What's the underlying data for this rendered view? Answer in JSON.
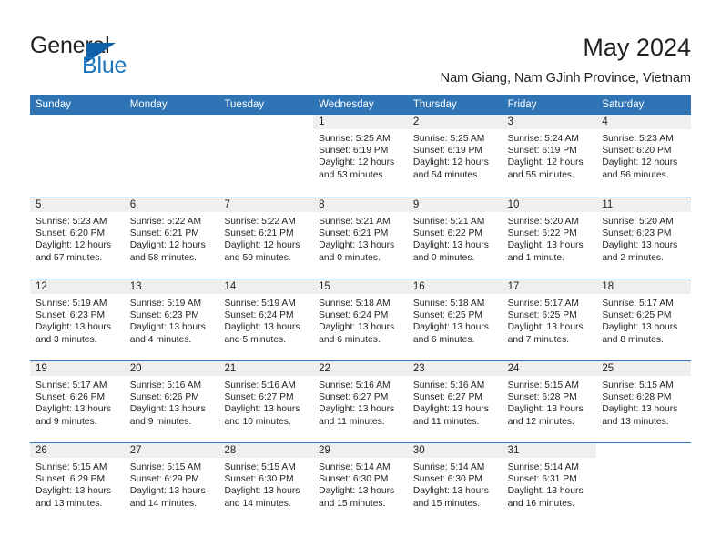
{
  "brand": {
    "name_part1": "General",
    "name_part2": "Blue",
    "accent_color": "#1b75bc",
    "triangle_color": "#1060a8"
  },
  "header": {
    "title": "May 2024",
    "subtitle": "Nam Giang, Nam GJinh Province, Vietnam",
    "header_bg_color": "#2f74b5",
    "daynum_strip_color": "#efefef"
  },
  "calendar": {
    "weekdays": [
      "Sunday",
      "Monday",
      "Tuesday",
      "Wednesday",
      "Thursday",
      "Friday",
      "Saturday"
    ],
    "weeks": [
      [
        {
          "empty": true
        },
        {
          "empty": true
        },
        {
          "empty": true
        },
        {
          "day": "1",
          "sunrise": "Sunrise: 5:25 AM",
          "sunset": "Sunset: 6:19 PM",
          "daylight1": "Daylight: 12 hours",
          "daylight2": "and 53 minutes."
        },
        {
          "day": "2",
          "sunrise": "Sunrise: 5:25 AM",
          "sunset": "Sunset: 6:19 PM",
          "daylight1": "Daylight: 12 hours",
          "daylight2": "and 54 minutes."
        },
        {
          "day": "3",
          "sunrise": "Sunrise: 5:24 AM",
          "sunset": "Sunset: 6:19 PM",
          "daylight1": "Daylight: 12 hours",
          "daylight2": "and 55 minutes."
        },
        {
          "day": "4",
          "sunrise": "Sunrise: 5:23 AM",
          "sunset": "Sunset: 6:20 PM",
          "daylight1": "Daylight: 12 hours",
          "daylight2": "and 56 minutes."
        }
      ],
      [
        {
          "day": "5",
          "sunrise": "Sunrise: 5:23 AM",
          "sunset": "Sunset: 6:20 PM",
          "daylight1": "Daylight: 12 hours",
          "daylight2": "and 57 minutes."
        },
        {
          "day": "6",
          "sunrise": "Sunrise: 5:22 AM",
          "sunset": "Sunset: 6:21 PM",
          "daylight1": "Daylight: 12 hours",
          "daylight2": "and 58 minutes."
        },
        {
          "day": "7",
          "sunrise": "Sunrise: 5:22 AM",
          "sunset": "Sunset: 6:21 PM",
          "daylight1": "Daylight: 12 hours",
          "daylight2": "and 59 minutes."
        },
        {
          "day": "8",
          "sunrise": "Sunrise: 5:21 AM",
          "sunset": "Sunset: 6:21 PM",
          "daylight1": "Daylight: 13 hours",
          "daylight2": "and 0 minutes."
        },
        {
          "day": "9",
          "sunrise": "Sunrise: 5:21 AM",
          "sunset": "Sunset: 6:22 PM",
          "daylight1": "Daylight: 13 hours",
          "daylight2": "and 0 minutes."
        },
        {
          "day": "10",
          "sunrise": "Sunrise: 5:20 AM",
          "sunset": "Sunset: 6:22 PM",
          "daylight1": "Daylight: 13 hours",
          "daylight2": "and 1 minute."
        },
        {
          "day": "11",
          "sunrise": "Sunrise: 5:20 AM",
          "sunset": "Sunset: 6:23 PM",
          "daylight1": "Daylight: 13 hours",
          "daylight2": "and 2 minutes."
        }
      ],
      [
        {
          "day": "12",
          "sunrise": "Sunrise: 5:19 AM",
          "sunset": "Sunset: 6:23 PM",
          "daylight1": "Daylight: 13 hours",
          "daylight2": "and 3 minutes."
        },
        {
          "day": "13",
          "sunrise": "Sunrise: 5:19 AM",
          "sunset": "Sunset: 6:23 PM",
          "daylight1": "Daylight: 13 hours",
          "daylight2": "and 4 minutes."
        },
        {
          "day": "14",
          "sunrise": "Sunrise: 5:19 AM",
          "sunset": "Sunset: 6:24 PM",
          "daylight1": "Daylight: 13 hours",
          "daylight2": "and 5 minutes."
        },
        {
          "day": "15",
          "sunrise": "Sunrise: 5:18 AM",
          "sunset": "Sunset: 6:24 PM",
          "daylight1": "Daylight: 13 hours",
          "daylight2": "and 6 minutes."
        },
        {
          "day": "16",
          "sunrise": "Sunrise: 5:18 AM",
          "sunset": "Sunset: 6:25 PM",
          "daylight1": "Daylight: 13 hours",
          "daylight2": "and 6 minutes."
        },
        {
          "day": "17",
          "sunrise": "Sunrise: 5:17 AM",
          "sunset": "Sunset: 6:25 PM",
          "daylight1": "Daylight: 13 hours",
          "daylight2": "and 7 minutes."
        },
        {
          "day": "18",
          "sunrise": "Sunrise: 5:17 AM",
          "sunset": "Sunset: 6:25 PM",
          "daylight1": "Daylight: 13 hours",
          "daylight2": "and 8 minutes."
        }
      ],
      [
        {
          "day": "19",
          "sunrise": "Sunrise: 5:17 AM",
          "sunset": "Sunset: 6:26 PM",
          "daylight1": "Daylight: 13 hours",
          "daylight2": "and 9 minutes."
        },
        {
          "day": "20",
          "sunrise": "Sunrise: 5:16 AM",
          "sunset": "Sunset: 6:26 PM",
          "daylight1": "Daylight: 13 hours",
          "daylight2": "and 9 minutes."
        },
        {
          "day": "21",
          "sunrise": "Sunrise: 5:16 AM",
          "sunset": "Sunset: 6:27 PM",
          "daylight1": "Daylight: 13 hours",
          "daylight2": "and 10 minutes."
        },
        {
          "day": "22",
          "sunrise": "Sunrise: 5:16 AM",
          "sunset": "Sunset: 6:27 PM",
          "daylight1": "Daylight: 13 hours",
          "daylight2": "and 11 minutes."
        },
        {
          "day": "23",
          "sunrise": "Sunrise: 5:16 AM",
          "sunset": "Sunset: 6:27 PM",
          "daylight1": "Daylight: 13 hours",
          "daylight2": "and 11 minutes."
        },
        {
          "day": "24",
          "sunrise": "Sunrise: 5:15 AM",
          "sunset": "Sunset: 6:28 PM",
          "daylight1": "Daylight: 13 hours",
          "daylight2": "and 12 minutes."
        },
        {
          "day": "25",
          "sunrise": "Sunrise: 5:15 AM",
          "sunset": "Sunset: 6:28 PM",
          "daylight1": "Daylight: 13 hours",
          "daylight2": "and 13 minutes."
        }
      ],
      [
        {
          "day": "26",
          "sunrise": "Sunrise: 5:15 AM",
          "sunset": "Sunset: 6:29 PM",
          "daylight1": "Daylight: 13 hours",
          "daylight2": "and 13 minutes."
        },
        {
          "day": "27",
          "sunrise": "Sunrise: 5:15 AM",
          "sunset": "Sunset: 6:29 PM",
          "daylight1": "Daylight: 13 hours",
          "daylight2": "and 14 minutes."
        },
        {
          "day": "28",
          "sunrise": "Sunrise: 5:15 AM",
          "sunset": "Sunset: 6:30 PM",
          "daylight1": "Daylight: 13 hours",
          "daylight2": "and 14 minutes."
        },
        {
          "day": "29",
          "sunrise": "Sunrise: 5:14 AM",
          "sunset": "Sunset: 6:30 PM",
          "daylight1": "Daylight: 13 hours",
          "daylight2": "and 15 minutes."
        },
        {
          "day": "30",
          "sunrise": "Sunrise: 5:14 AM",
          "sunset": "Sunset: 6:30 PM",
          "daylight1": "Daylight: 13 hours",
          "daylight2": "and 15 minutes."
        },
        {
          "day": "31",
          "sunrise": "Sunrise: 5:14 AM",
          "sunset": "Sunset: 6:31 PM",
          "daylight1": "Daylight: 13 hours",
          "daylight2": "and 16 minutes."
        },
        {
          "empty": true
        }
      ]
    ]
  }
}
